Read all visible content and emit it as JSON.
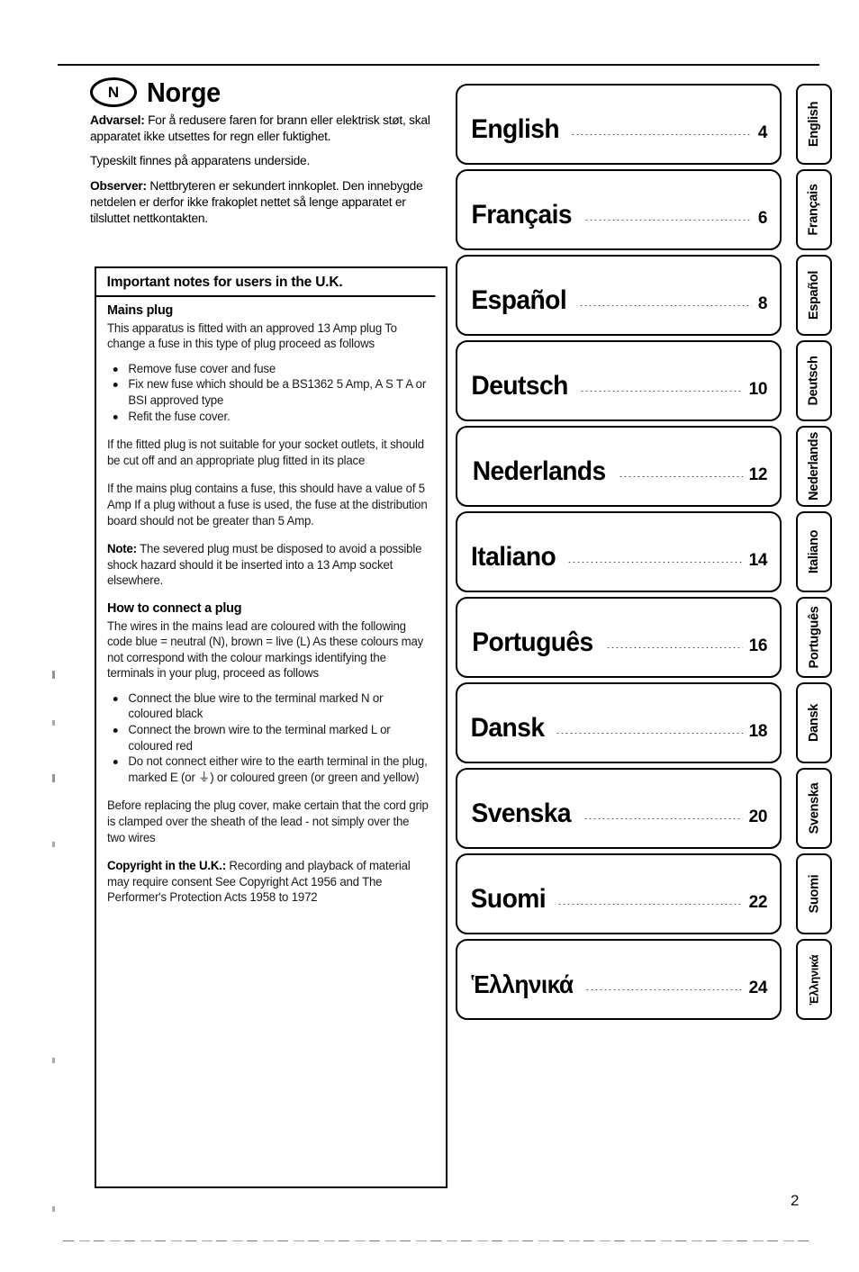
{
  "page": {
    "folio": "2"
  },
  "norway_notice": {
    "country_code": "N",
    "country_name": "Norge",
    "paragraphs": [
      {
        "lead": "Advarsel:",
        "text": " For å redusere faren for brann eller elektrisk støt, skal apparatet ikke utsettes for regn eller fuktighet."
      },
      {
        "lead": "",
        "text": "Typeskilt finnes på apparatens underside."
      },
      {
        "lead": "Observer:",
        "text": " Nettbryteren er sekundert innkoplet. Den innebygde netdelen er derfor ikke frakoplet nettet så lenge apparatet er tilsluttet nettkontakten."
      }
    ]
  },
  "uk_notes": {
    "title": "Important notes for users in the U.K.",
    "mains_plug_heading": "Mains plug",
    "mains_plug_intro": "This apparatus is fitted with an approved 13 Amp plug To change a fuse in this type of plug proceed as follows",
    "mains_plug_steps": [
      "Remove fuse cover and fuse",
      "Fix new fuse which should be a BS1362 5 Amp, A S T A  or BSI approved type",
      "Refit the fuse cover."
    ],
    "para_unsuitable": "If the fitted plug is not suitable for your socket outlets, it should be cut off and an appropriate plug fitted in its place",
    "para_fuse_value": "If the mains plug contains a fuse, this should have a value of 5 Amp  If a plug without a fuse is used, the fuse at the distribution board should not be greater than 5 Amp.",
    "note_lead": "Note:",
    "note_text": " The severed plug must be disposed to avoid a possible shock hazard should it be inserted into a 13 Amp socket elsewhere.",
    "connect_heading": "How to connect a plug",
    "connect_intro": "The wires in the mains lead are coloured with the following code  blue = neutral (N), brown = live (L) As these colours may not correspond with the colour markings identifying the terminals in your plug, proceed as follows",
    "connect_steps": [
      "Connect the blue wire to the terminal marked N or coloured black",
      "Connect the brown wire to the terminal marked L or coloured red",
      "Do not connect either wire to the earth terminal in the plug, marked E (or ⏚) or coloured green (or green and yellow)"
    ],
    "para_cord_grip": "Before replacing the plug cover, make certain that the cord grip is clamped over the sheath of the lead - not simply over the two wires",
    "copyright_lead": "Copyright in the U.K.:",
    "copyright_text": " Recording and playback of material may require consent  See Copyright Act 1956 and The Performer's Protection Acts 1958 to 1972"
  },
  "contents": [
    {
      "language": "English",
      "page": "4",
      "tab": "English"
    },
    {
      "language": "Français",
      "page": "6",
      "tab": "Français"
    },
    {
      "language": "Español",
      "page": "8",
      "tab": "Español"
    },
    {
      "language": "Deutsch",
      "page": "10",
      "tab": "Deutsch"
    },
    {
      "language": "Nederlands",
      "page": "12",
      "tab": "Nederlands"
    },
    {
      "language": "Italiano",
      "page": "14",
      "tab": "Italiano"
    },
    {
      "language": "Português",
      "page": "16",
      "tab": "Português"
    },
    {
      "language": "Dansk",
      "page": "18",
      "tab": "Dansk"
    },
    {
      "language": "Svenska",
      "page": "20",
      "tab": "Svenska"
    },
    {
      "language": "Suomi",
      "page": "22",
      "tab": "Suomi"
    },
    {
      "language": "Ἑλληνικά",
      "page": "24",
      "tab": "Ἑλληνικά"
    }
  ],
  "contents_extra": [
    {
      "language": "Ἑλληνικά",
      "page": "24"
    }
  ]
}
